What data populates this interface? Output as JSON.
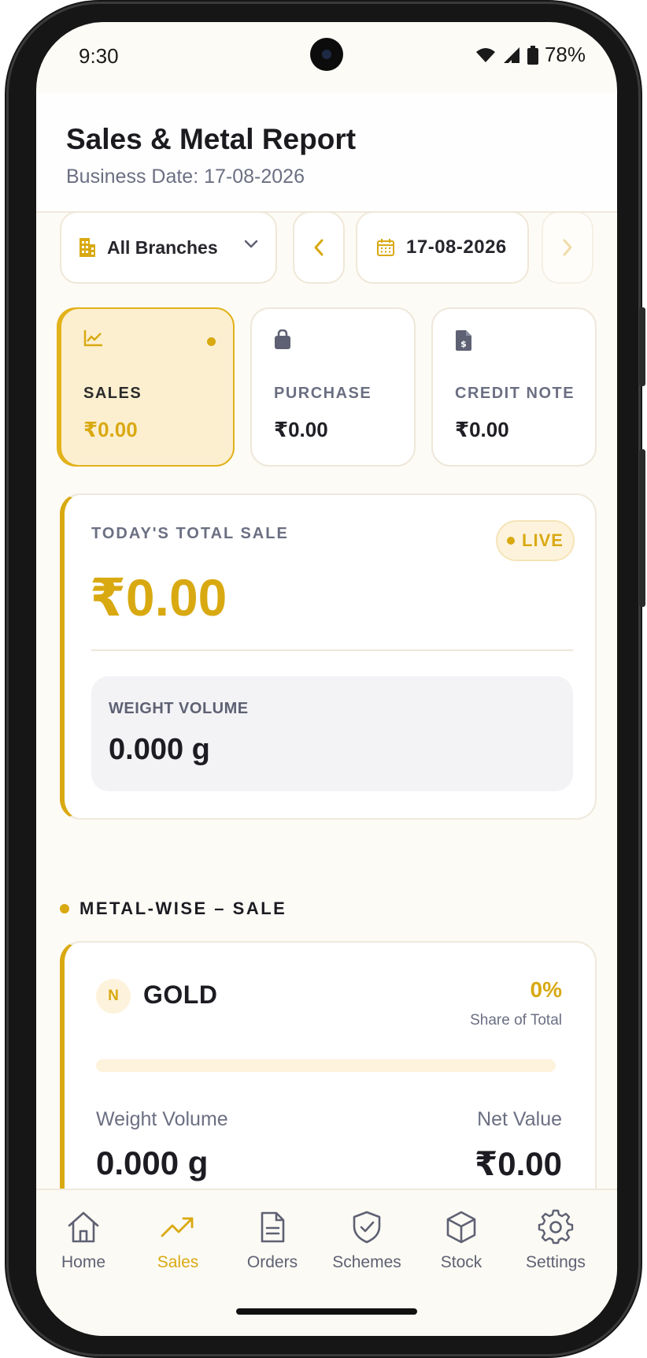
{
  "status_bar": {
    "time": "9:30",
    "battery": "78%"
  },
  "header": {
    "title": "Sales & Metal Report",
    "subtitle": "Business Date: 17-08-2026"
  },
  "filters": {
    "branch": "All Branches",
    "date": "17-08-2026"
  },
  "categories": [
    {
      "label": "SALES",
      "value": "₹0.00",
      "icon": "chart-line-icon",
      "active": true
    },
    {
      "label": "PURCHASE",
      "value": "₹0.00",
      "icon": "shopping-bag-icon",
      "active": false
    },
    {
      "label": "CREDIT NOTE",
      "value": "₹0.00",
      "icon": "document-dollar-icon",
      "active": false
    }
  ],
  "total_sale": {
    "label": "TODAY'S TOTAL SALE",
    "badge": "LIVE",
    "value": "₹0.00",
    "weight_label": "WEIGHT VOLUME",
    "weight_value": "0.000 g"
  },
  "metal_section": {
    "title": "METAL-WISE – SALE",
    "items": [
      {
        "badge": "N",
        "name": "GOLD",
        "share_value": "0%",
        "share_fraction": 0,
        "share_label": "Share of Total",
        "weight_label": "Weight Volume",
        "weight_value": "0.000 g",
        "net_label": "Net Value",
        "net_value": "₹0.00"
      }
    ]
  },
  "nav": {
    "items": [
      {
        "label": "Home",
        "icon": "home-icon",
        "active": false
      },
      {
        "label": "Sales",
        "icon": "trending-up-icon",
        "active": true
      },
      {
        "label": "Orders",
        "icon": "document-icon",
        "active": false
      },
      {
        "label": "Schemes",
        "icon": "shield-check-icon",
        "active": false
      },
      {
        "label": "Stock",
        "icon": "box-icon",
        "active": false
      },
      {
        "label": "Settings",
        "icon": "gear-icon",
        "active": false
      }
    ]
  },
  "colors": {
    "accent": "#d9a912",
    "muted": "#6b6f82",
    "background": "#fdfbf6"
  }
}
